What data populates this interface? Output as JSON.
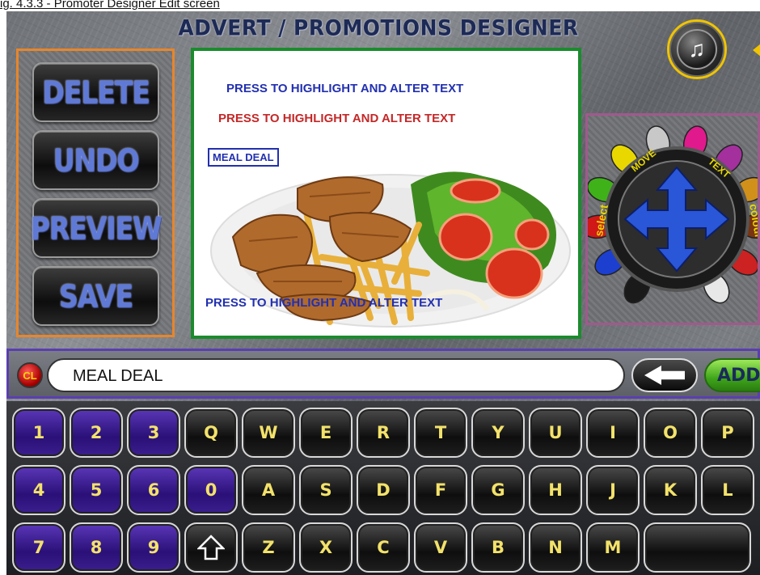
{
  "caption": "ig. 4.3.3 - Promoter Designer Edit screen",
  "title": "ADVERT / PROMOTIONS DESIGNER",
  "music_button": {
    "icon": "music-note-icon",
    "glyph": "♫"
  },
  "side_buttons": {
    "delete": "DELETE",
    "undo": "UNDO",
    "preview": "PREVIEW",
    "save": "SAVE"
  },
  "preview": {
    "line1": "PRESS TO HIGHLIGHT AND ALTER TEXT",
    "line2": "PRESS TO HIGHLIGHT AND ALTER TEXT",
    "selected_box": "MEAL DEAL",
    "line3": "PRESS TO HIGHLIGHT AND ALTER TEXT",
    "image": "meal-plate-image"
  },
  "dial": {
    "labels": {
      "select": "select",
      "move": "MOVE",
      "text": "TEXT",
      "colour": "colour"
    },
    "center_icon": "four-way-arrow-icon",
    "color_pegs": [
      "#1a1a1a",
      "#1d3fd0",
      "#d01818",
      "#3fb21a",
      "#e8d800",
      "#c8c8c8",
      "#e01a8c",
      "#a3309c",
      "#d0901a",
      "#7a3410",
      "#cc2222",
      "#e8e8e8"
    ]
  },
  "input_bar": {
    "clear_label": "CL",
    "value": "MEAL DEAL",
    "backspace_icon": "left-arrow-icon",
    "add_label": "ADD"
  },
  "keyboard": {
    "row1": [
      "1",
      "2",
      "3",
      "Q",
      "W",
      "E",
      "R",
      "T",
      "Y",
      "U",
      "I",
      "O",
      "P"
    ],
    "row2": [
      "4",
      "5",
      "6",
      "0",
      "A",
      "S",
      "D",
      "F",
      "G",
      "H",
      "J",
      "K",
      "L"
    ],
    "row3": [
      "7",
      "8",
      "9",
      "",
      "Z",
      "X",
      "C",
      "V",
      "B",
      "N",
      "M"
    ],
    "shift_icon": "shift-arrow-icon",
    "space_label": ""
  },
  "colors": {
    "accent_title": "#1d2a55",
    "button_text": "#5f79d6",
    "key_text": "#f3e26a",
    "number_key": "#3b1f8f"
  }
}
